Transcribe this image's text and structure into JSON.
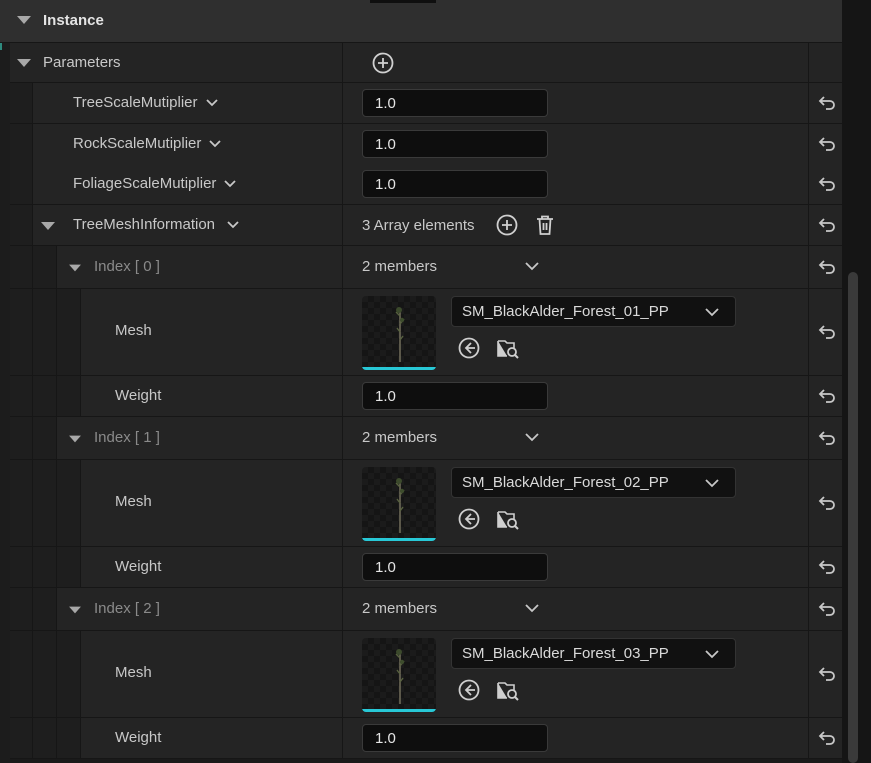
{
  "category": {
    "title": "Instance"
  },
  "parameters": {
    "label": "Parameters",
    "simple_params": [
      {
        "name": "TreeScaleMutiplier",
        "value": "1.0"
      },
      {
        "name": "RockScaleMutiplier",
        "value": "1.0"
      },
      {
        "name": "FoliageScaleMutiplier",
        "value": "1.0"
      }
    ],
    "tree_mesh": {
      "name": "TreeMeshInformation",
      "count_text": "3 Array elements",
      "elements": [
        {
          "index_label": "Index [ 0 ]",
          "members_text": "2 members",
          "mesh_label": "Mesh",
          "mesh_asset": "SM_BlackAlder_Forest_01_PP",
          "weight_label": "Weight",
          "weight": "1.0"
        },
        {
          "index_label": "Index [ 1 ]",
          "members_text": "2 members",
          "mesh_label": "Mesh",
          "mesh_asset": "SM_BlackAlder_Forest_02_PP",
          "weight_label": "Weight",
          "weight": "1.0"
        },
        {
          "index_label": "Index [ 2 ]",
          "members_text": "2 members",
          "mesh_label": "Mesh",
          "mesh_asset": "SM_BlackAlder_Forest_03_PP",
          "weight_label": "Weight",
          "weight": "1.0"
        }
      ]
    }
  },
  "icons": {
    "expand": "triangle-down-icon",
    "add": "plus-circle-icon",
    "delete": "trash-icon",
    "reset": "reset-arrow-icon",
    "dropdown": "chevron-down-icon",
    "use_selected": "arrow-left-circle-icon",
    "browse": "folder-search-icon"
  },
  "colors": {
    "accent_thumbnail_bar": "#28c8d6",
    "panel_bg": "#242424",
    "input_bg": "#0e0e0e"
  }
}
